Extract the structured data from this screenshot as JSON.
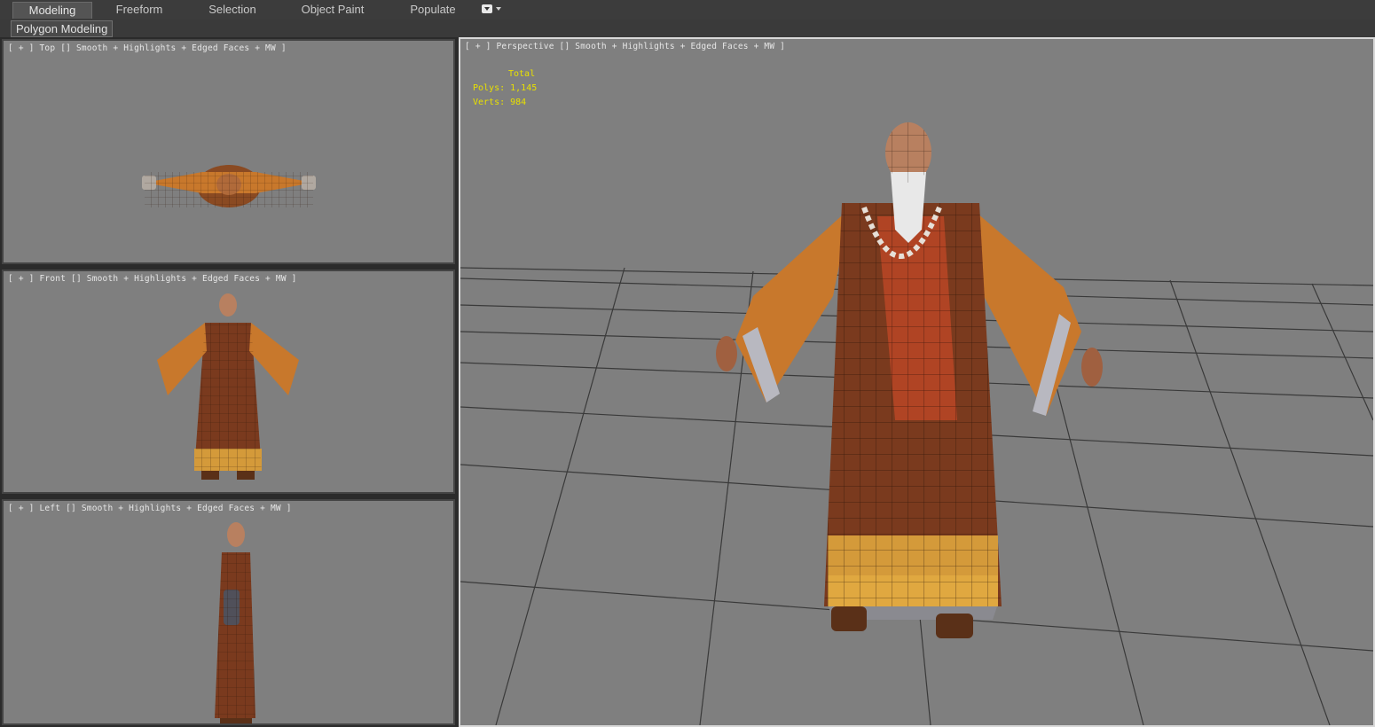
{
  "ribbon": {
    "tabs": [
      "Modeling",
      "Freeform",
      "Selection",
      "Object Paint",
      "Populate"
    ],
    "active_tab": "Modeling",
    "panel_label": "Polygon Modeling"
  },
  "viewports": {
    "top": {
      "label": "[ + ] Top [] Smooth + Highlights + Edged Faces + MW ]"
    },
    "front": {
      "label": "[ + ] Front [] Smooth + Highlights + Edged Faces + MW ]"
    },
    "left": {
      "label": "[ + ] Left [] Smooth + Highlights + Edged Faces + MW ]"
    },
    "perspective": {
      "label": "[ + ] Perspective [] Smooth + Highlights + Edged Faces + MW ]"
    }
  },
  "stats": {
    "header": "Total",
    "polys": "Polys: 1,145",
    "verts": "Verts: 984"
  },
  "colors": {
    "viewport_bg": "#7f7f7f",
    "stats_text": "#e8e000",
    "robe_orange": "#c8782c",
    "robe_brown": "#7a3a1e"
  }
}
